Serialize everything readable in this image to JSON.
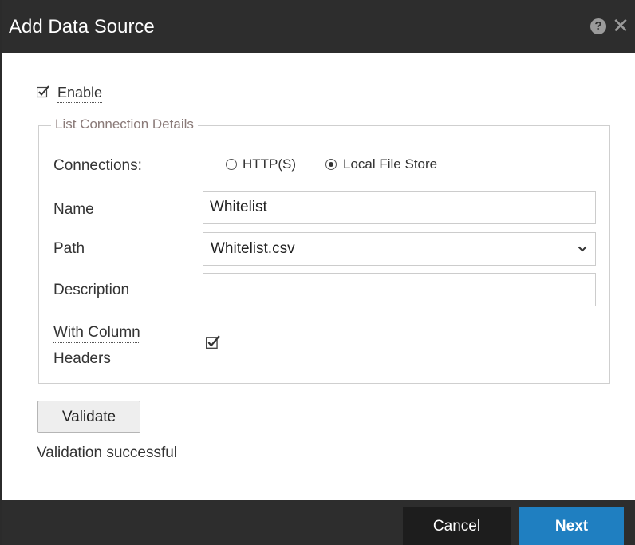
{
  "dialog": {
    "title": "Add Data Source",
    "help_glyph": "?",
    "close_glyph": "✕"
  },
  "enable": {
    "label": "Enable",
    "checked": true
  },
  "section": {
    "legend": "List Connection Details",
    "connections": {
      "label": "Connections:",
      "options": [
        {
          "label": "HTTP(S)",
          "selected": false
        },
        {
          "label": "Local File Store",
          "selected": true
        }
      ]
    },
    "name": {
      "label": "Name",
      "value": "Whitelist",
      "placeholder": ""
    },
    "path": {
      "label": "Path",
      "value": "Whitelist.csv"
    },
    "description": {
      "label": "Description",
      "value": "",
      "placeholder": ""
    },
    "column_headers": {
      "label_line1": "With Column",
      "label_line2": "Headers",
      "checked": true
    }
  },
  "validate_button": "Validate",
  "validation_status": "Validation successful",
  "footer": {
    "cancel_label": "Cancel",
    "next_label": "Next"
  },
  "colors": {
    "titlebar": "#2d2d2d",
    "next_button": "#1f7fc1",
    "cancel_button": "#1d1d1d",
    "legend_text": "#8a7a78"
  },
  "icons": [
    "help-icon",
    "close-icon",
    "checkbox-checked-icon",
    "radio-icon",
    "chevron-down-icon"
  ]
}
